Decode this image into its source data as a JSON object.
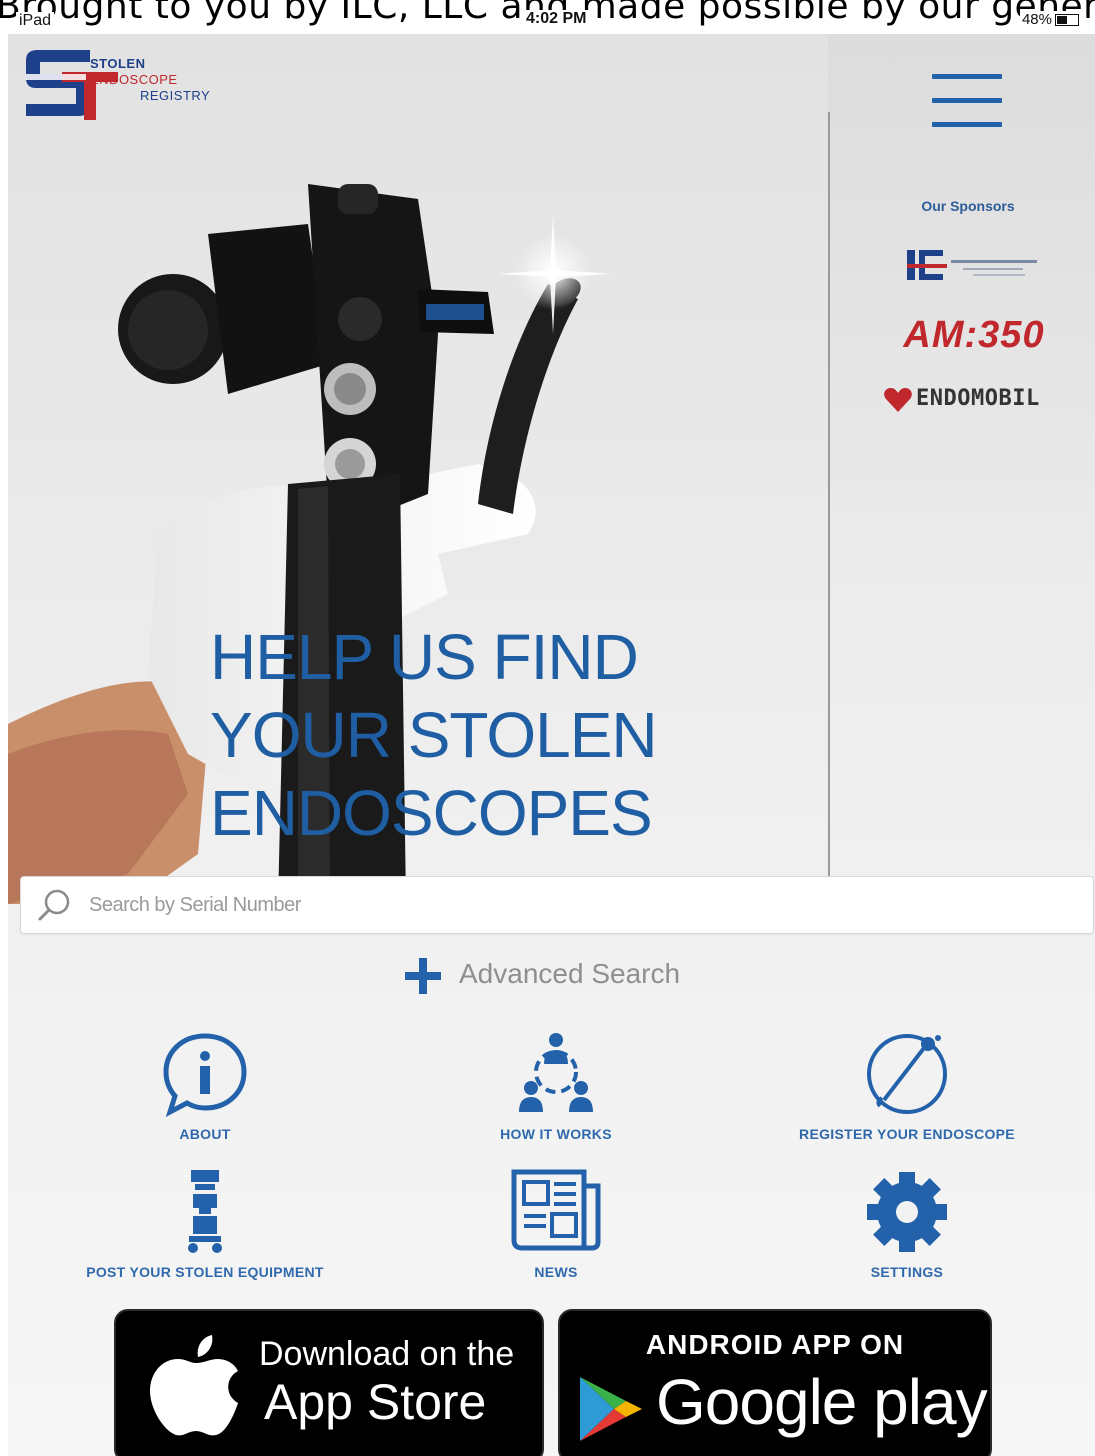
{
  "top_banner": {
    "text": "Brought to you by ILC, LLC and made possible by our generous sponsors"
  },
  "status_bar": {
    "carrier": "iPad",
    "time": "4:02 PM",
    "battery": "48%"
  },
  "logo": {
    "line1": "STOLEN",
    "line2": "ENDOSCOPE",
    "line3": "REGISTRY"
  },
  "sponsors": {
    "title": "Our Sponsors",
    "items": [
      {
        "name": "ILC"
      },
      {
        "name": "AM:350"
      },
      {
        "name": "ENDOMOBIL"
      }
    ]
  },
  "hero": {
    "heading_lines": [
      "HELP US FIND",
      "YOUR STOLEN",
      "ENDOSCOPES"
    ]
  },
  "search": {
    "placeholder": "Search by Serial Number",
    "value": ""
  },
  "advanced_search": {
    "label": "Advanced Search"
  },
  "tiles": [
    {
      "label": "ABOUT",
      "icon": "info-bubble-icon"
    },
    {
      "label": "HOW IT WORKS",
      "icon": "network-people-icon"
    },
    {
      "label": "REGISTER YOUR ENDOSCOPE",
      "icon": "endoscope-icon"
    },
    {
      "label": "POST YOUR STOLEN EQUIPMENT",
      "icon": "equipment-cart-icon"
    },
    {
      "label": "NEWS",
      "icon": "newspaper-icon"
    },
    {
      "label": "SETTINGS",
      "icon": "gear-icon"
    }
  ],
  "store_badges": {
    "apple": {
      "line1": "Download on the",
      "line2": "App Store"
    },
    "google": {
      "line1": "ANDROID APP ON",
      "line2": "Google play"
    }
  },
  "colors": {
    "brand_blue": "#1f5ea3",
    "link_blue": "#2f69ad",
    "menu_blue": "#2362aa"
  }
}
